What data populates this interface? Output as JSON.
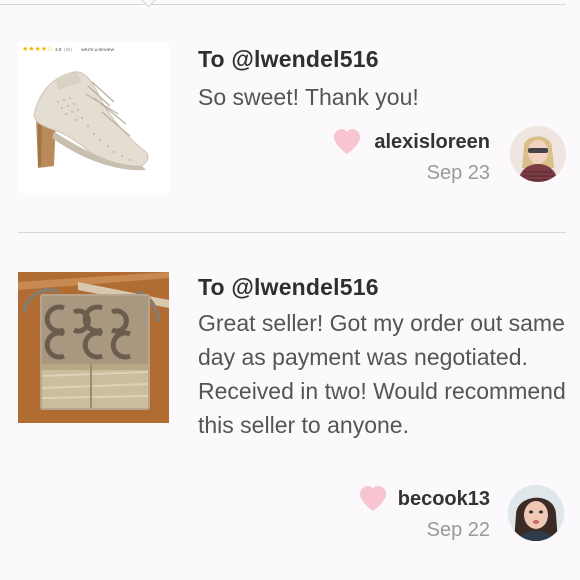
{
  "reviews": [
    {
      "to": "To @lwendel516",
      "message": "So sweet! Thank you!",
      "username": "alexisloreen",
      "date": "Sep 23",
      "product_image": "shoe-product",
      "product_rating": "3.8",
      "product_rating_count": "(28)",
      "product_review_link": "WRITE A REVIEW"
    },
    {
      "to": "To @lwendel516",
      "message": "Great seller! Got my order out same day as payment was negotiated. Received in two! Would recommend this seller to anyone.",
      "username": "becook13",
      "date": "Sep 22",
      "product_image": "handbag-product"
    }
  ],
  "colors": {
    "heart": "#f7c4cf",
    "background": "#fbf9fb",
    "divider": "#d8d8d8"
  }
}
